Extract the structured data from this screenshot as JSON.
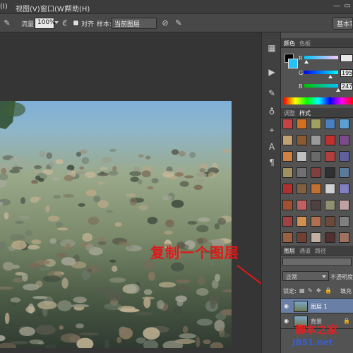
{
  "menubar": {
    "items": [
      "(I)",
      "视图(V)",
      "窗口(W)",
      "帮助(H)"
    ]
  },
  "options_bar": {
    "flow_label": "流量:",
    "flow_value": "100%",
    "align_label": "对齐",
    "sample_label": "样本:",
    "sample_value": "当前图层",
    "workspace_button": "基本功能"
  },
  "color_panel": {
    "tabs": [
      "颜色",
      "色板"
    ],
    "r_label": "R",
    "g_label": "G",
    "b_label": "B",
    "r_value": "",
    "g_value": "195",
    "b_value": "247",
    "foreground_color": "#25c3f7",
    "background_color": "#000000"
  },
  "styles_panel": {
    "tabs": [
      "调整",
      "样式"
    ]
  },
  "layers_panel": {
    "tabs": [
      "图层",
      "通道",
      "路径"
    ],
    "blend_mode": "正常",
    "opacity_label": "不透明度",
    "lock_label": "锁定:",
    "fill_label": "填充",
    "layers": [
      {
        "name": "图层 1",
        "selected": true
      },
      {
        "name": "背景",
        "selected": false
      }
    ]
  },
  "annotation": {
    "text": "复制一个图层"
  },
  "watermark": {
    "line1": "脚本之家",
    "line2": "JB51.net"
  }
}
